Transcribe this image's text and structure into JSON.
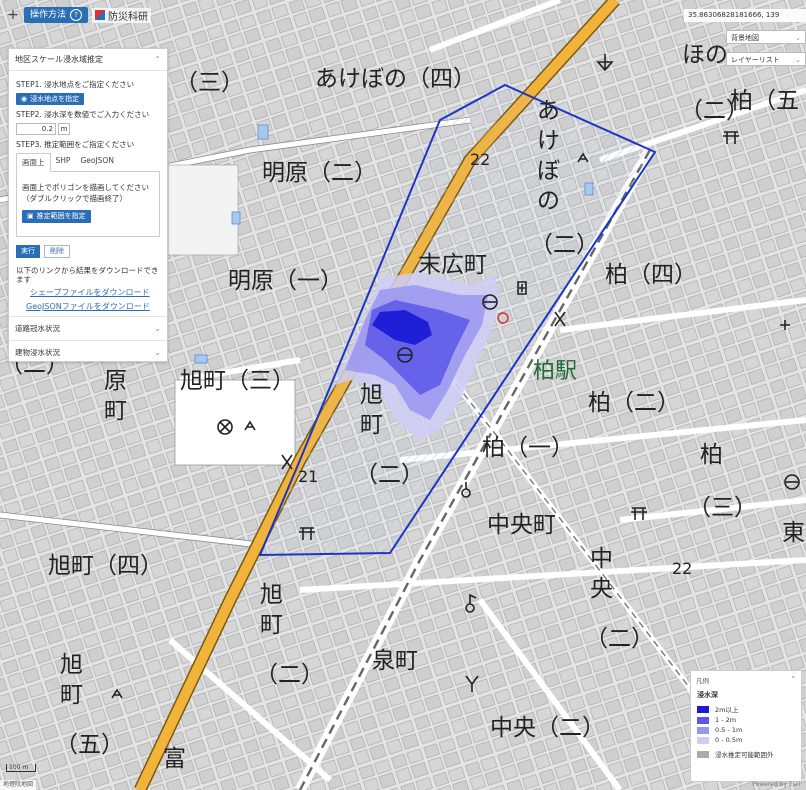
{
  "toolbar": {
    "plus": "+",
    "ops_label": "操作方法",
    "help": "?",
    "brand": "防災科研"
  },
  "panel": {
    "title": "地区スケール浸水域推定",
    "step1": "STEP1. 浸水地点をご指定ください",
    "step1_button": "浸水地点を指定",
    "step2": "STEP2. 浸水深を数値でご入力ください",
    "depth_value": "0.2",
    "depth_unit": "m",
    "step3": "STEP3. 推定範囲をご指定ください",
    "tabs": [
      "画面上",
      "SHP",
      "GeoJSON"
    ],
    "draw_hint_1": "画面上でポリゴンを描画してください",
    "draw_hint_2": "（ダブルクリックで描画終了）",
    "range_button": "推定範囲を指定",
    "run_button": "実行",
    "delete_button": "削除",
    "download_text": "以下のリンクから結果をダウンロードできます",
    "link_shp": "シェープファイルをダウンロード",
    "link_geojson": "GeoJSONファイルをダウンロード",
    "acc_road": "道路冠水状況",
    "acc_building": "建物浸水状況"
  },
  "controls": {
    "coords": "35.86306828181666, 139",
    "base_map": "背景地図",
    "layer_list": "レイヤーリスト"
  },
  "legend": {
    "header": "凡例",
    "title": "浸水深",
    "items": [
      {
        "label": "2m以上",
        "color": "#1b1bd6"
      },
      {
        "label": "1 - 2m",
        "color": "#5c57e8"
      },
      {
        "label": "0.5 - 1m",
        "color": "#9a95f0"
      },
      {
        "label": "0 - 0.5m",
        "color": "#cfccf6"
      },
      {
        "label": "浸水推定可能範囲外",
        "color": "#aaaaaa"
      }
    ]
  },
  "map_labels": {
    "akebono4": "あけぼの（四）",
    "san_nw": "（三）",
    "meihara2": "明原（二）",
    "meihara1": "明原（一）",
    "suehiro": "末広町",
    "akebono_v": [
      "あ",
      "け",
      "ぼ",
      "の",
      "（二）"
    ],
    "kashiwa4": "柏（四）",
    "kashiwa_station": "柏駅",
    "kashiwa2": "柏（二）",
    "kashiwa1": "柏（一）",
    "asahicho3": "旭町（三）",
    "harumachi": [
      "原",
      "町"
    ],
    "asahicho_v": [
      "旭",
      "町",
      "（二）"
    ],
    "chuocho": "中央町",
    "asahicho4": "旭町（四）",
    "asahi_v2": [
      "旭",
      "町",
      "（二）"
    ],
    "izumicho": "泉町",
    "chuo2": "中央（二）",
    "asahi_v5": [
      "旭",
      "町",
      "（五）"
    ],
    "chuo_v": [
      "中",
      "央",
      "（二）"
    ],
    "tomi": "富",
    "kashiwa_r": "柏",
    "kashiwa_r3": "（三）",
    "higashi": "東",
    "kashiwa5": "柏（五",
    "hono": "ほの",
    "ni_top": "（二）",
    "ni_left": "（二）",
    "route22_a": "22",
    "route22_b": "22",
    "route21": "21"
  },
  "scale": "100 m",
  "attribution_left": "地理院地図",
  "attribution_right": "Powered by Esri"
}
